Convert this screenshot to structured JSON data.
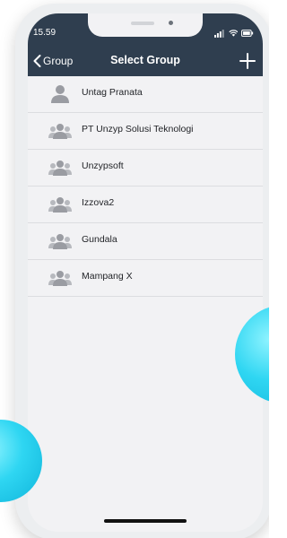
{
  "status_bar": {
    "time": "15.59",
    "icons": [
      "signal-icon",
      "wifi-icon",
      "battery-icon"
    ]
  },
  "nav": {
    "back_label": "Group",
    "title": "Select Group",
    "add_icon": "plus-icon"
  },
  "groups": [
    {
      "label": "Untag Pranata",
      "icon": "person-icon"
    },
    {
      "label": "PT Unzyp Solusi Teknologi",
      "icon": "group-icon"
    },
    {
      "label": "Unzypsoft",
      "icon": "group-icon"
    },
    {
      "label": "Izzova2",
      "icon": "group-icon"
    },
    {
      "label": "Gundala",
      "icon": "group-icon"
    },
    {
      "label": "Mampang X",
      "icon": "group-icon"
    }
  ],
  "colors": {
    "header": "#2f3e4f",
    "list_background": "#f2f2f4",
    "icon_gray": "#9a9ca2",
    "accent_orb": "#2fd6f2"
  }
}
